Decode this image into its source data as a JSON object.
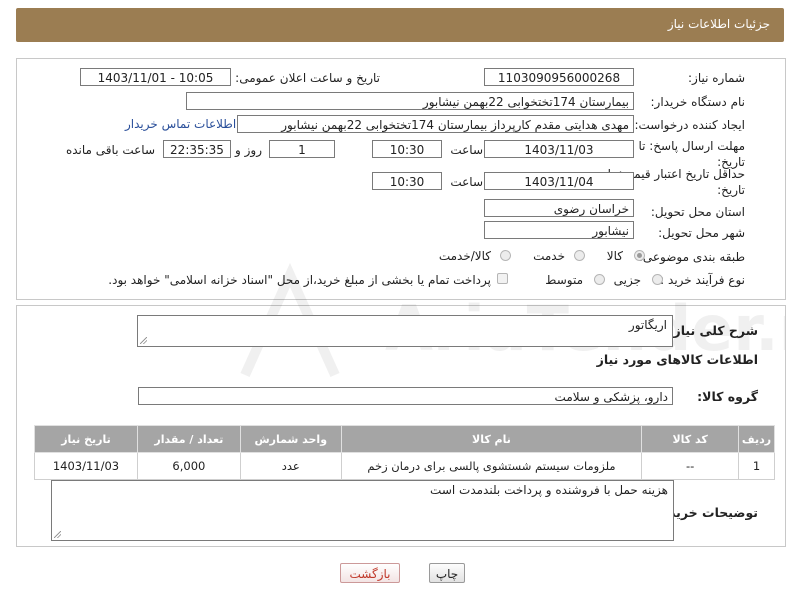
{
  "header": {
    "title": "جزئیات اطلاعات نیاز"
  },
  "form": {
    "need_number_label": "شماره نیاز:",
    "need_number": "1103090956000268",
    "announce_label": "تاریخ و ساعت اعلان عمومی:",
    "announce_value": "1403/11/01 - 10:05",
    "buyer_org_label": "نام دستگاه خریدار:",
    "buyer_org": "بیمارستان 174تختخوابی 22بهمن نیشابور",
    "creator_label": "ایجاد کننده درخواست:",
    "creator": "مهدی هدایتی مقدم کارپرداز بیمارستان 174تختخوابی 22بهمن نیشابور",
    "contact_link": "اطلاعات تماس خریدار",
    "reply_deadline_label": "مهلت ارسال پاسخ: تا تاریخ:",
    "reply_date": "1403/11/03",
    "time_label": "ساعت",
    "reply_time": "10:30",
    "days_value": "1",
    "days_label": "روز و",
    "remaining_time": "22:35:35",
    "remaining_label": "ساعت باقی مانده",
    "price_validity_label": "حداقل تاریخ اعتبار قیمت: تا تاریخ:",
    "price_date": "1403/11/04",
    "price_time": "10:30",
    "province_label": "استان محل تحویل:",
    "province": "خراسان رضوی",
    "city_label": "شهر محل تحویل:",
    "city": "نیشابور",
    "category_label": "طبقه بندی موضوعی:",
    "category_options": [
      "کالا",
      "خدمت",
      "کالا/خدمت"
    ],
    "category_selected": "کالا",
    "process_label": "نوع فرآیند خرید :",
    "process_options": [
      "جزیی",
      "متوسط"
    ],
    "payment_note": "پرداخت تمام یا بخشی از مبلغ خرید،از محل \"اسناد خزانه اسلامی\" خواهد بود."
  },
  "details": {
    "summary_label": "شرح کلی نیاز:",
    "summary": "اریگاتور",
    "goods_info_title": "اطلاعات کالاهای مورد نیاز",
    "goods_group_label": "گروه کالا:",
    "goods_group": "دارو، پزشکی و سلامت",
    "table": {
      "headers": [
        "ردیف",
        "کد کالا",
        "نام کالا",
        "واحد شمارش",
        "تعداد / مقدار",
        "تاریخ نیاز"
      ],
      "rows": [
        [
          "1",
          "--",
          "ملزومات سیستم شستشوی پالسی برای درمان زخم",
          "عدد",
          "6,000",
          "1403/11/03"
        ]
      ]
    },
    "buyer_notes_label": "توضیحات خریدار:",
    "buyer_notes": "هزینه حمل با فروشنده و پرداخت بلندمدت است"
  },
  "buttons": {
    "print": "چاپ",
    "back": "بازگشت"
  },
  "watermark_text": "AriaTender.net",
  "colors": {
    "header_bg": "#9b7d52",
    "table_header_bg": "#a5a5a5",
    "link": "#2a4f9a",
    "back_btn_text": "#c0392b"
  }
}
